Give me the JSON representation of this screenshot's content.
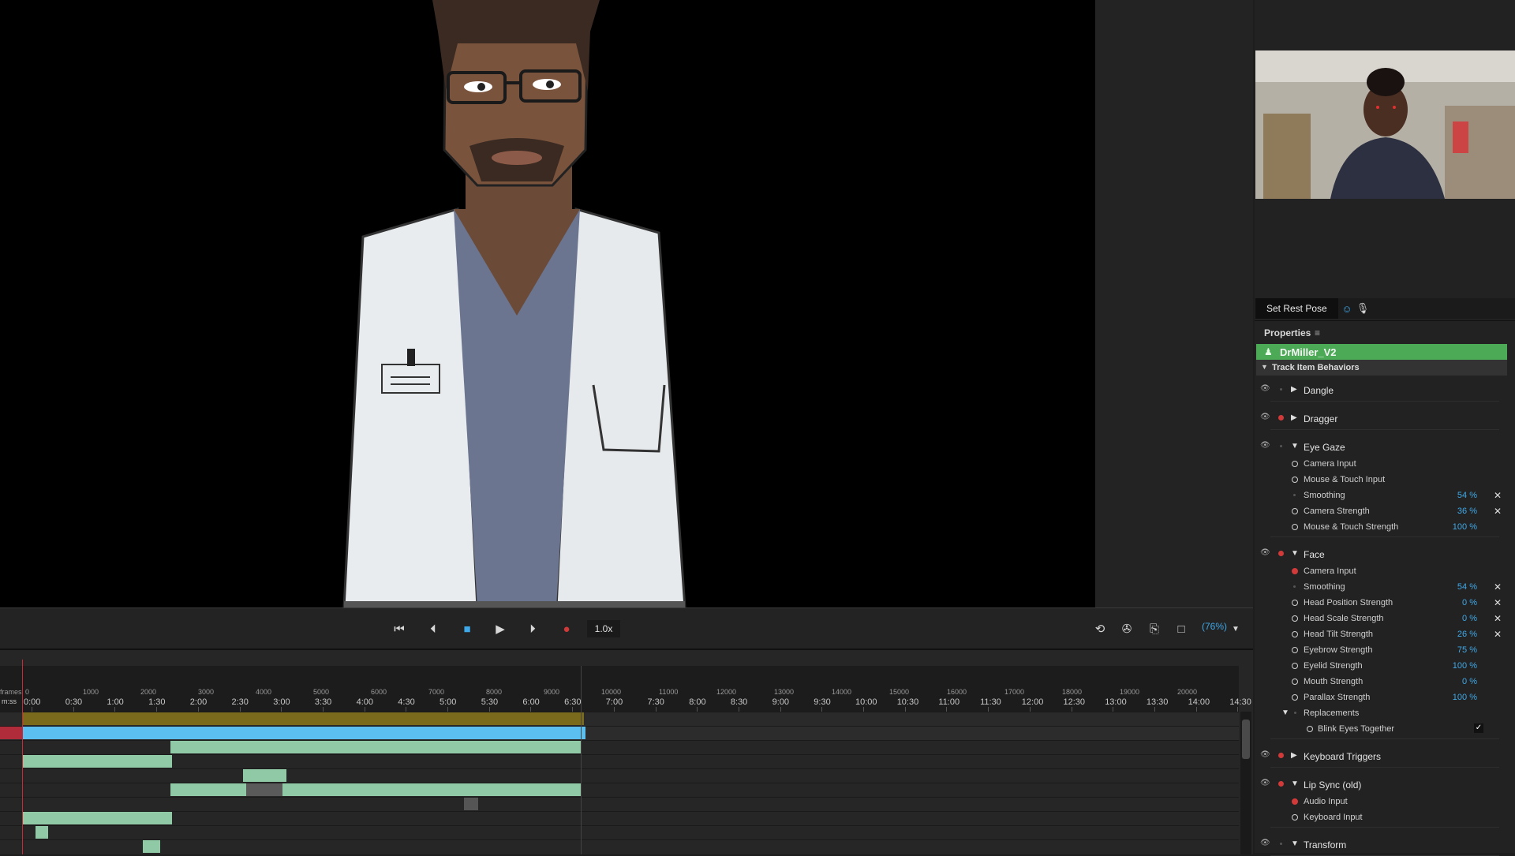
{
  "stage": {
    "character": "Dr. Miller puppet (lab coat)"
  },
  "transport": {
    "speed": "1.0x",
    "zoom": "(76%)",
    "buttons": [
      "go-to-start",
      "step-back",
      "stop",
      "play",
      "step-forward",
      "record"
    ]
  },
  "timeline": {
    "frame_label": "frames",
    "time_label": "m:ss",
    "frame_ticks": [
      "0",
      "1000",
      "2000",
      "3000",
      "4000",
      "5000",
      "6000",
      "7000",
      "8000",
      "9000",
      "10000",
      "11000",
      "12000",
      "13000",
      "14000",
      "15000",
      "16000",
      "17000",
      "18000",
      "19000",
      "20000"
    ],
    "time_ticks": [
      "0:00",
      "0:30",
      "1:00",
      "1:30",
      "2:00",
      "2:30",
      "3:00",
      "3:30",
      "4:00",
      "4:30",
      "5:00",
      "5:30",
      "6:00",
      "6:30",
      "7:00",
      "7:30",
      "8:00",
      "8:30",
      "9:00",
      "9:30",
      "10:00",
      "10:30",
      "11:00",
      "11:30",
      "12:00",
      "12:30",
      "13:00",
      "13:30",
      "14:00",
      "14:30"
    ]
  },
  "camera_panel": {
    "set_rest_pose": "Set Rest Pose"
  },
  "properties": {
    "title": "Properties",
    "puppet_name": "DrMiller_V2",
    "section": "Track Item Behaviors",
    "behaviors": [
      {
        "name": "Dangle",
        "armed": false,
        "expanded": false,
        "params": []
      },
      {
        "name": "Dragger",
        "armed": true,
        "expanded": false,
        "params": []
      },
      {
        "name": "Eye Gaze",
        "armed": false,
        "expanded": true,
        "params": [
          {
            "label": "Camera Input",
            "value": "",
            "kind": "ring"
          },
          {
            "label": "Mouse & Touch Input",
            "value": "",
            "kind": "ring"
          },
          {
            "label": "Smoothing",
            "value": "54 %",
            "kind": "dim",
            "x": true
          },
          {
            "label": "Camera Strength",
            "value": "36 %",
            "kind": "ring",
            "x": true
          },
          {
            "label": "Mouse & Touch Strength",
            "value": "100 %",
            "kind": "ring"
          }
        ]
      },
      {
        "name": "Face",
        "armed": true,
        "expanded": true,
        "params": [
          {
            "label": "Camera Input",
            "value": "",
            "kind": "red"
          },
          {
            "label": "Smoothing",
            "value": "54 %",
            "kind": "dim",
            "x": true
          },
          {
            "label": "Head Position Strength",
            "value": "0 %",
            "kind": "ring",
            "x": true
          },
          {
            "label": "Head Scale Strength",
            "value": "0 %",
            "kind": "ring",
            "x": true
          },
          {
            "label": "Head Tilt Strength",
            "value": "26 %",
            "kind": "ring",
            "x": true
          },
          {
            "label": "Eyebrow Strength",
            "value": "75 %",
            "kind": "ring"
          },
          {
            "label": "Eyelid Strength",
            "value": "100 %",
            "kind": "ring"
          },
          {
            "label": "Mouth Strength",
            "value": "0 %",
            "kind": "ring"
          },
          {
            "label": "Parallax Strength",
            "value": "100 %",
            "kind": "ring"
          }
        ]
      },
      {
        "name": "Keyboard Triggers",
        "armed": true,
        "expanded": false,
        "params": []
      },
      {
        "name": "Lip Sync (old)",
        "armed": true,
        "expanded": true,
        "params": [
          {
            "label": "Audio Input",
            "value": "",
            "kind": "red"
          },
          {
            "label": "Keyboard Input",
            "value": "",
            "kind": "ring"
          }
        ]
      },
      {
        "name": "Transform",
        "armed": false,
        "expanded": true,
        "params": []
      }
    ],
    "replacements_label": "Replacements",
    "blink_label": "Blink Eyes Together"
  },
  "colors": {
    "accent_blue": "#3fa8e8",
    "puppet_green": "#4caa57",
    "record_red": "#d23a3a",
    "track_green": "#8fc9a5",
    "track_gold": "#7a6a1c"
  }
}
